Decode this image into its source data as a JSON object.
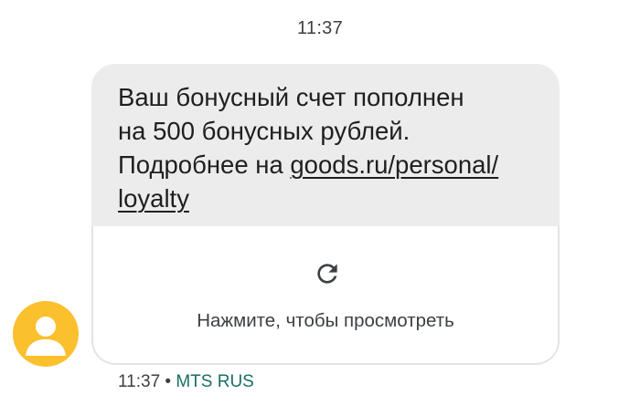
{
  "thread": {
    "top_timestamp": "11:37"
  },
  "message": {
    "line1": "Ваш бонусный счет пополнен",
    "line2": "на 500 бонусных рублей.",
    "line3_prefix": "Подробнее на ",
    "link_part1": "goods.ru/personal/",
    "link_part2": "loyalty"
  },
  "preview": {
    "icon": "refresh-icon",
    "label": "Нажмите, чтобы просмотреть"
  },
  "status": {
    "time": "11:37",
    "separator": " • ",
    "sim": "MTS RUS"
  },
  "avatar": {
    "icon": "person-icon",
    "color": "#fbc02d"
  },
  "colors": {
    "bubble_bg": "#ececec",
    "sim_accent": "#1a6f64"
  }
}
